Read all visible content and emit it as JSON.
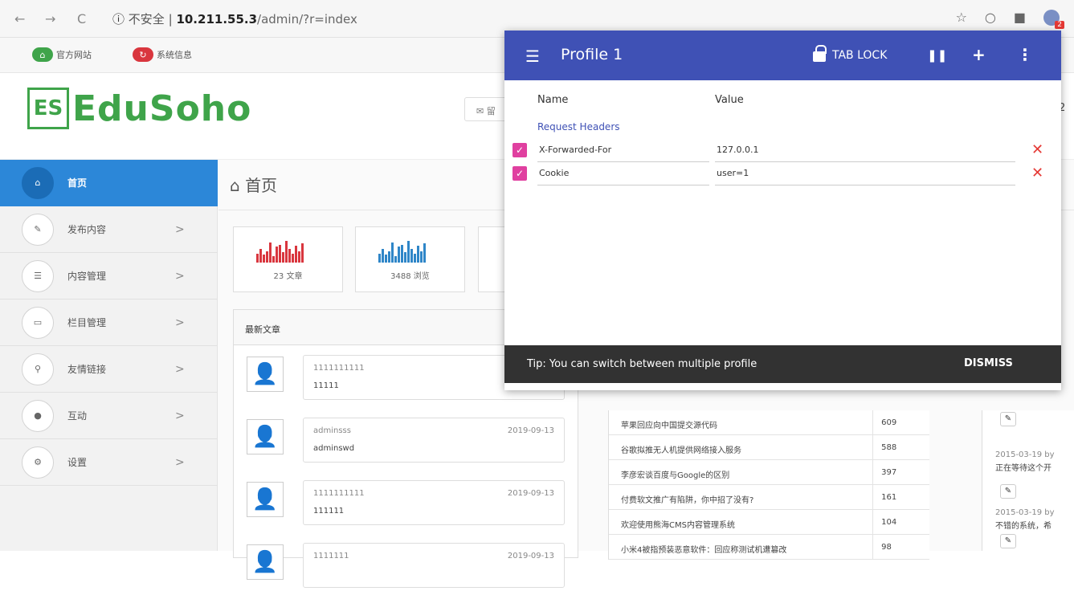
{
  "browser": {
    "back": "←",
    "forward": "→",
    "reload": "C",
    "info_icon": "ⓘ",
    "insecure": "不安全",
    "separator": "|",
    "host": "10.211.55.3",
    "path": "/admin/?r=index",
    "star": "☆",
    "ext_badge": "2"
  },
  "topbar": {
    "official_site": "官方网站",
    "system_info": "系统信息"
  },
  "logo": {
    "mark": "ES",
    "text": "EduSoho"
  },
  "header": {
    "msg_button": "✉ 留",
    "right_fragment": "2"
  },
  "sidebar": {
    "items": [
      {
        "label": "首页",
        "icon": "home-icon",
        "glyph": "⌂",
        "chev": ""
      },
      {
        "label": "发布内容",
        "icon": "pencil-icon",
        "glyph": "✎",
        "chev": ">"
      },
      {
        "label": "内容管理",
        "icon": "list-icon",
        "glyph": "☰",
        "chev": ">"
      },
      {
        "label": "栏目管理",
        "icon": "window-icon",
        "glyph": "▭",
        "chev": ">"
      },
      {
        "label": "友情链接",
        "icon": "link-icon",
        "glyph": "⚲",
        "chev": ">"
      },
      {
        "label": "互动",
        "icon": "chat-icon",
        "glyph": "●",
        "chev": ">"
      },
      {
        "label": "设置",
        "icon": "gear-icon",
        "glyph": "⚙",
        "chev": ">"
      }
    ]
  },
  "main": {
    "title": "首页",
    "stats": [
      {
        "caption": "23 文章",
        "color": "#d9363e",
        "bars": [
          0.4,
          0.6,
          0.35,
          0.5,
          0.9,
          0.3,
          0.7,
          0.8,
          0.45,
          0.95,
          0.6,
          0.4,
          0.75,
          0.5,
          0.85
        ]
      },
      {
        "caption": "3488 浏览",
        "color": "#2f86c8",
        "bars": [
          0.4,
          0.6,
          0.35,
          0.5,
          0.9,
          0.3,
          0.7,
          0.8,
          0.45,
          0.95,
          0.6,
          0.4,
          0.75,
          0.5,
          0.85
        ]
      }
    ],
    "latest_title": "最新文章",
    "articles": [
      {
        "title": "1111111111",
        "date": "2",
        "body": "11111"
      },
      {
        "title": "adminsss",
        "date": "2019-09-13",
        "body": "adminswd"
      },
      {
        "title": "1111111111",
        "date": "2019-09-13",
        "body": "111111"
      },
      {
        "title": "1111111",
        "date": "2019-09-13",
        "body": ""
      }
    ],
    "hot_rows": [
      {
        "title": "苹果回应向中国提交源代码",
        "views": "609"
      },
      {
        "title": "谷歌拟推无人机提供网络接入服务",
        "views": "588"
      },
      {
        "title": "李彦宏谈百度与Google的区别",
        "views": "397"
      },
      {
        "title": "付费软文推广有陷阱，你中招了没有?",
        "views": "161"
      },
      {
        "title": "欢迎使用熊海CMS内容管理系统",
        "views": "104"
      },
      {
        "title": "小米4被指预装恶意软件：回应称测试机遭篡改",
        "views": "98"
      }
    ],
    "comments": [
      {
        "meta": "2015-03-19 by",
        "text": "正在等待这个开"
      },
      {
        "meta": "2015-03-19 by",
        "text": "不错的系统，希"
      }
    ]
  },
  "popup": {
    "title": "Profile 1",
    "tab_lock": "TAB LOCK",
    "pause": "❚❚",
    "add": "+",
    "more": "⋮",
    "col_name": "Name",
    "col_value": "Value",
    "section": "Request Headers",
    "headers": [
      {
        "name": "X-Forwarded-For",
        "value": "127.0.0.1"
      },
      {
        "name": "Cookie",
        "value": "user=1"
      }
    ],
    "tip": "Tip: You can switch between multiple profile",
    "dismiss": "DISMISS"
  },
  "colors": {
    "accent": "#3f51b5",
    "sidebar_active": "#2c87d8",
    "brand": "#3fa44a",
    "checkbox": "#e040a0",
    "delete": "#e53935"
  }
}
